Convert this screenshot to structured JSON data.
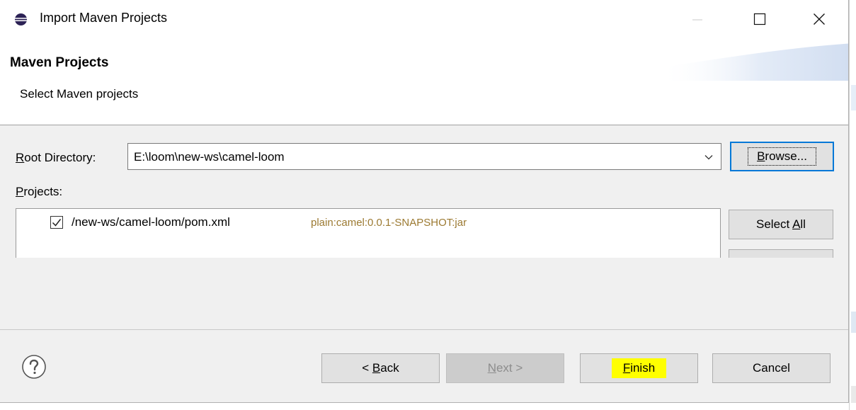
{
  "window": {
    "title": "Import Maven Projects",
    "icon": "eclipse-icon",
    "controls": [
      "minimize-icon",
      "maximize-icon",
      "close-icon"
    ]
  },
  "header": {
    "title": "Maven Projects",
    "subtitle": "Select Maven projects"
  },
  "root_directory": {
    "label_underlined": "R",
    "label_rest": "oot Directory:",
    "value": "E:\\loom\\new-ws\\camel-loom",
    "browse_underlined": "B",
    "browse_rest": "rowse..."
  },
  "projects": {
    "label_underlined": "P",
    "label_rest": "rojects:",
    "items": [
      {
        "checked": true,
        "path": "/new-ws/camel-loom/pom.xml",
        "coords": "plain:camel:0.0.1-SNAPSHOT:jar"
      }
    ],
    "select_all_prefix": "Select ",
    "select_all_underlined": "A",
    "select_all_suffix": "ll"
  },
  "footer": {
    "help_icon": "help-icon",
    "back_prefix": "< ",
    "back_underlined": "B",
    "back_rest": "ack",
    "next_underlined": "N",
    "next_rest": "ext >",
    "finish_underlined": "F",
    "finish_rest": "inish",
    "cancel": "Cancel"
  },
  "colors": {
    "accent": "#0078d7",
    "highlight": "#ffff00",
    "meta_text": "#9c7a32"
  }
}
